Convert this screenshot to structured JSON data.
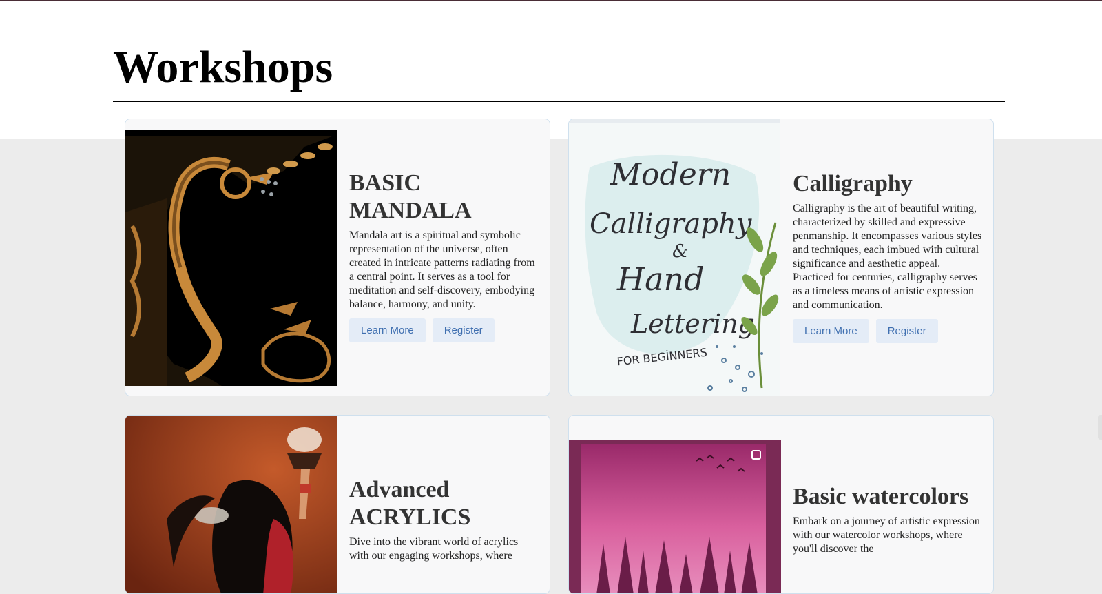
{
  "page": {
    "title": "Workshops"
  },
  "workshops": [
    {
      "title": "BASIC MANDALA",
      "description": "Mandala art is a spiritual and symbolic representation of the universe, often created in intricate patterns radiating from a central point. It serves as a tool for meditation and self-discovery, embodying balance, harmony, and unity.",
      "learn_more_label": "Learn More",
      "register_label": "Register"
    },
    {
      "title": "Calligraphy",
      "description": "Calligraphy is the art of beautiful writing, characterized by skilled and expressive penmanship. It encompasses various styles and techniques, each imbued with cultural significance and aesthetic appeal. Practiced for centuries, calligraphy serves as a timeless means of artistic expression and communication.",
      "learn_more_label": "Learn More",
      "register_label": "Register",
      "image_text": {
        "line1": "Modern",
        "line2": "Calligraphy",
        "line3": "&",
        "line4": "Hand",
        "line5": "Lettering",
        "line6": "FOR BEGİNNERS"
      }
    },
    {
      "title": "Advanced ACRYLICS",
      "description": "Dive into the vibrant world of acrylics with our engaging workshops, where"
    },
    {
      "title": "Basic watercolors",
      "description": "Embark on a journey of artistic expression with our watercolor workshops, where you'll discover the"
    }
  ],
  "colors": {
    "accent_top": "#4a2d36",
    "button_bg": "#e4ecf7",
    "button_text": "#3f6fb0",
    "card_border": "#cfe0ee"
  }
}
